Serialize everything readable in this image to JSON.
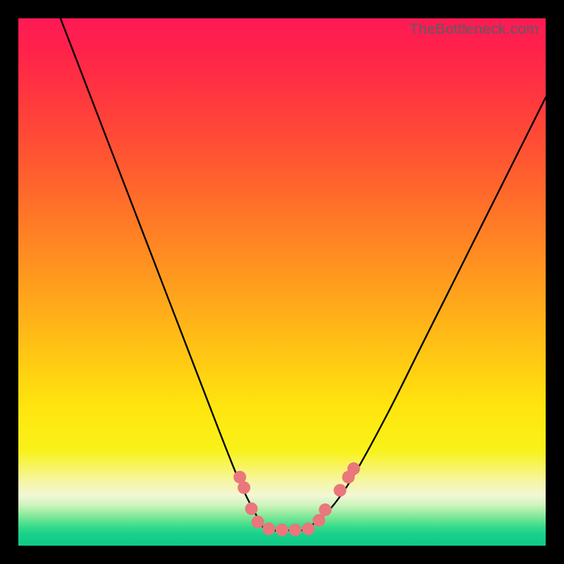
{
  "watermark": "TheBottleneck.com",
  "chart_data": {
    "type": "line",
    "title": "",
    "xlabel": "",
    "ylabel": "",
    "xlim": [
      0,
      100
    ],
    "ylim": [
      0,
      100
    ],
    "grid": false,
    "legend": false,
    "series": [
      {
        "name": "bottleneck-curve",
        "x": [
          8,
          13,
          18,
          23,
          28,
          33,
          38,
          42,
          45,
          47,
          50,
          54,
          57,
          60,
          64,
          70,
          76,
          82,
          88,
          94,
          100
        ],
        "y": [
          100,
          87,
          74,
          61,
          48,
          35,
          22,
          12,
          6,
          3,
          3,
          3,
          5,
          8,
          14,
          25,
          37,
          49,
          61,
          73,
          85
        ]
      }
    ],
    "markers": [
      {
        "name": "left-dot-1",
        "x": 42.0,
        "y": 13.0
      },
      {
        "name": "left-dot-2",
        "x": 42.8,
        "y": 11.0
      },
      {
        "name": "left-cap-top",
        "x": 44.2,
        "y": 7.0
      },
      {
        "name": "left-cap-bot",
        "x": 45.4,
        "y": 4.5
      },
      {
        "name": "valley-1",
        "x": 47.5,
        "y": 3.2
      },
      {
        "name": "valley-2",
        "x": 50.0,
        "y": 3.0
      },
      {
        "name": "valley-3",
        "x": 52.5,
        "y": 3.0
      },
      {
        "name": "valley-4",
        "x": 55.0,
        "y": 3.2
      },
      {
        "name": "right-cap-bot",
        "x": 57.0,
        "y": 4.8
      },
      {
        "name": "right-cap-top",
        "x": 58.2,
        "y": 6.8
      },
      {
        "name": "right-gap-dot",
        "x": 61.0,
        "y": 10.5
      },
      {
        "name": "right-dot-1",
        "x": 62.6,
        "y": 13.0
      },
      {
        "name": "right-dot-2",
        "x": 63.6,
        "y": 14.6
      }
    ],
    "marker_color": "#e9777b",
    "curve_color": "#000000",
    "gradient_stops": [
      {
        "pos": 0,
        "color": "#ff1a55"
      },
      {
        "pos": 16,
        "color": "#ff3a3d"
      },
      {
        "pos": 40,
        "color": "#ff7e25"
      },
      {
        "pos": 63,
        "color": "#ffc414"
      },
      {
        "pos": 82,
        "color": "#f9f21a"
      },
      {
        "pos": 90.5,
        "color": "#f2f7d6"
      },
      {
        "pos": 96.5,
        "color": "#34db8a"
      },
      {
        "pos": 100,
        "color": "#0fc987"
      }
    ]
  }
}
